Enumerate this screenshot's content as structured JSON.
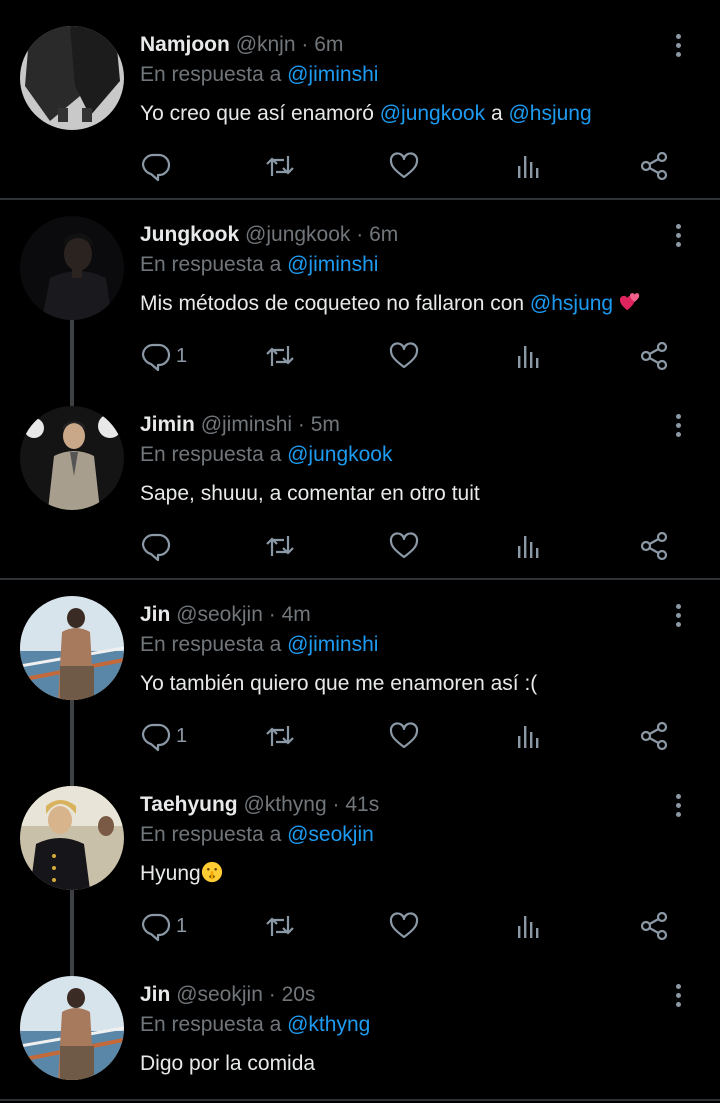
{
  "reply_prefix": "En respuesta a",
  "colors": {
    "background": "#000000",
    "mention": "#1d9bf0",
    "secondary": "#71767b",
    "divider": "#2f3336"
  },
  "tweets": [
    {
      "name": "Namjoon",
      "handle": "@knjn",
      "time": "6m",
      "reply_to": "@jiminshi",
      "text_parts": [
        "Yo creo que así enamoró ",
        "@jungkook",
        " a ",
        "@hsjung"
      ],
      "reply_count": ""
    },
    {
      "name": "Jungkook",
      "handle": "@jungkook",
      "time": "6m",
      "reply_to": "@jiminshi",
      "text_parts": [
        "Mis métodos de coqueteo no fallaron con ",
        "@hsjung"
      ],
      "emoji": "two-hearts",
      "reply_count": "1"
    },
    {
      "name": "Jimin",
      "handle": "@jiminshi",
      "time": "5m",
      "reply_to": "@jungkook",
      "text": "Sape, shuuu, a comentar en otro tuit",
      "reply_count": ""
    },
    {
      "name": "Jin",
      "handle": "@seokjin",
      "time": "4m",
      "reply_to": "@jiminshi",
      "text": "Yo también quiero que me enamoren así :(",
      "reply_count": "1"
    },
    {
      "name": "Taehyung",
      "handle": "@kthyng",
      "time": "41s",
      "reply_to": "@seokjin",
      "text": "Hyung",
      "emoji": "shushing-face",
      "reply_count": "1"
    },
    {
      "name": "Jin",
      "handle": "@seokjin",
      "time": "20s",
      "reply_to": "@kthyng",
      "text": "Digo por la comida"
    }
  ]
}
